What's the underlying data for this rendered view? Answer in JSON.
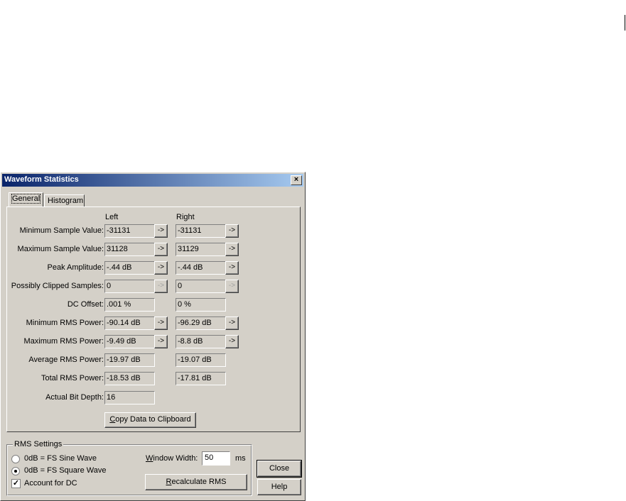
{
  "window": {
    "title": "Waveform Statistics",
    "close_glyph": "×"
  },
  "tabs": [
    {
      "label": "General",
      "active": true
    },
    {
      "label": "Histogram",
      "active": false
    }
  ],
  "columns": {
    "left": "Left",
    "right": "Right"
  },
  "stats": {
    "min_sample": {
      "label": "Minimum Sample Value:",
      "left": "-31131",
      "right": "-31131"
    },
    "max_sample": {
      "label": "Maximum Sample Value:",
      "left": "31128",
      "right": "31129"
    },
    "peak_amp": {
      "label": "Peak Amplitude:",
      "left": "-.44 dB",
      "right": "-.44 dB"
    },
    "clipped": {
      "label": "Possibly Clipped Samples:",
      "left": "0",
      "right": "0"
    },
    "dc_offset": {
      "label": "DC Offset:",
      "left": ".001 %",
      "right": "0 %"
    },
    "min_rms": {
      "label": "Minimum RMS Power:",
      "left": "-90.14 dB",
      "right": "-96.29 dB"
    },
    "max_rms": {
      "label": "Maximum RMS Power:",
      "left": "-9.49 dB",
      "right": "-8.8 dB"
    },
    "avg_rms": {
      "label": "Average RMS Power:",
      "left": "-19.97 dB",
      "right": "-19.07 dB"
    },
    "total_rms": {
      "label": "Total RMS Power:",
      "left": "-18.53 dB",
      "right": "-17.81 dB"
    },
    "bit_depth": {
      "label": "Actual Bit Depth:",
      "left": "16"
    }
  },
  "arrow_glyph": "->",
  "copy_button": {
    "pre": "",
    "accel": "C",
    "post": "opy Data to Clipboard"
  },
  "rms_settings": {
    "legend": "RMS Settings",
    "option_sine": "0dB = FS Sine Wave",
    "option_square": "0dB = FS Square Wave",
    "selected": "square",
    "account_dc": "Account for DC",
    "account_dc_checked": true,
    "check_glyph": "✓",
    "window_width_accel": "W",
    "window_width_rest": "indow Width:",
    "window_width_value": "50",
    "window_width_unit": "ms",
    "recalc_accel": "R",
    "recalc_rest": "ecalculate RMS"
  },
  "buttons": {
    "close": "Close",
    "help": "Help"
  }
}
